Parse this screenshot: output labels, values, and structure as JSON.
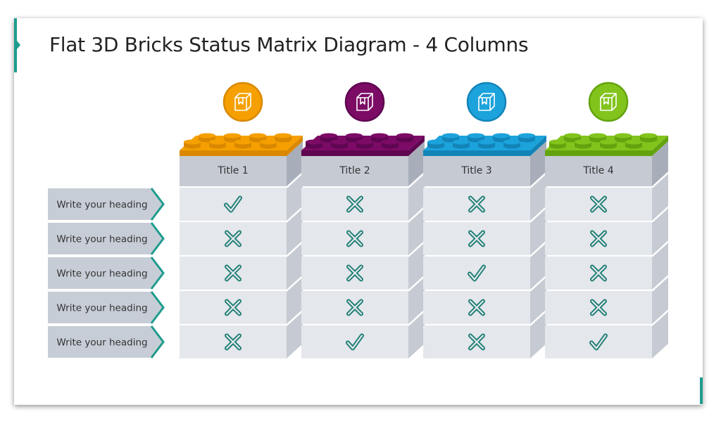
{
  "title": "Flat 3D Bricks Status Matrix Diagram - 4 Columns",
  "accent_color": "#1E9C8E",
  "mark_color": "#1E7F74",
  "columns": [
    {
      "label": "Title 1",
      "color": "#F5A000",
      "dark": "#D98800",
      "icon": "package-box-icon"
    },
    {
      "label": "Title 2",
      "color": "#7C0B66",
      "dark": "#5E0650",
      "icon": "package-box-icon"
    },
    {
      "label": "Title 3",
      "color": "#1CA3DC",
      "dark": "#1384B8",
      "icon": "package-box-icon"
    },
    {
      "label": "Title 4",
      "color": "#82C41C",
      "dark": "#63A30E",
      "icon": "package-box-icon"
    }
  ],
  "rows": [
    {
      "heading": "Write your heading",
      "status": [
        "check",
        "cross",
        "cross",
        "cross"
      ]
    },
    {
      "heading": "Write your heading",
      "status": [
        "cross",
        "cross",
        "cross",
        "cross"
      ]
    },
    {
      "heading": "Write your heading",
      "status": [
        "cross",
        "cross",
        "check",
        "cross"
      ]
    },
    {
      "heading": "Write your heading",
      "status": [
        "cross",
        "cross",
        "cross",
        "cross"
      ]
    },
    {
      "heading": "Write your heading",
      "status": [
        "cross",
        "check",
        "cross",
        "check"
      ]
    }
  ]
}
